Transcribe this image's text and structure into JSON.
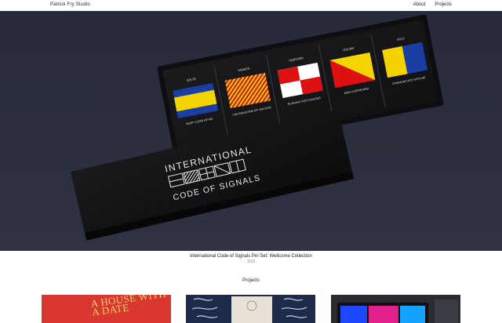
{
  "site": {
    "brand": "Patrick Fry Studio",
    "nav": [
      "About",
      "Projects"
    ]
  },
  "hero": {
    "caption": "International Code of Signals Pin Set: Wellcome Collection",
    "counter": "1/10"
  },
  "artwork": {
    "box_title_line1": "INTERNATIONAL",
    "box_title_line2": "CODE OF SIGNALS",
    "flags": [
      {
        "name": "DELTA",
        "meaning": "KEEP CLEAR OF ME"
      },
      {
        "name": "YANKEE",
        "meaning": "I AM DRAGGING MY ANCHOR"
      },
      {
        "name": "UNIFORM",
        "meaning": "RUNNING INTO DANGER"
      },
      {
        "name": "OSCAR",
        "meaning": "MAN OVERBOARD"
      },
      {
        "name": "KILO",
        "meaning": "COMMUNICATE WITH ME"
      }
    ]
  },
  "projects": {
    "heading": "Projects",
    "items": [
      {
        "label": "A HOUSE WITH A DATE",
        "accent": "#d8362f"
      },
      {
        "label": "",
        "accent": "#1d2a4a"
      },
      {
        "label": "",
        "accent": "#2a2a2f"
      }
    ]
  }
}
